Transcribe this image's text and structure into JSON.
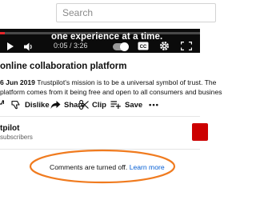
{
  "search": {
    "placeholder": "Search"
  },
  "player": {
    "caption": "one experience at a time.",
    "time": "0:05 / 3:26",
    "progress": 0.025,
    "accent_color": "#e6262b",
    "controls": [
      "play-icon",
      "volume-icon",
      "autoplay-toggle",
      "captions-icon",
      "gear-icon",
      "fullscreen-icon"
    ]
  },
  "video": {
    "title": "online collaboration platform",
    "date": "6 Jun 2019",
    "description_line1": "Trustpilot's mission is to be a universal symbol of trust. The",
    "description_line2": "platform comes from it being free and open to all consumers and busines"
  },
  "actions": {
    "dislike": "Dislike",
    "share": "Share",
    "clip": "Clip",
    "save": "Save",
    "more": "•••"
  },
  "channel": {
    "name": "tpilot",
    "subscribers": "subscribers",
    "subscribe_color": "#cc0000"
  },
  "comments": {
    "notice": "Comments are turned off.",
    "link": "Learn more",
    "link_color": "#065fd4",
    "highlight_color": "#f07b1f"
  }
}
